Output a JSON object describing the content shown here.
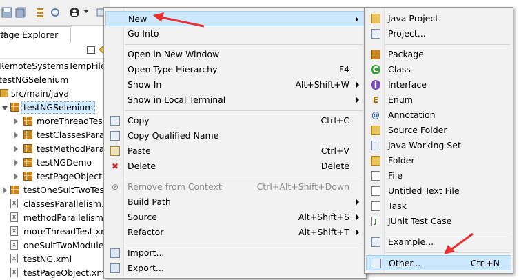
{
  "view": {
    "tab_label": "tage Explorer",
    "close_glyph": "✕"
  },
  "tree": [
    {
      "label": "RemoteSystemsTempFiles",
      "icon": "folder-icon"
    },
    {
      "label": "testNGSelenium",
      "icon": "project-icon"
    },
    {
      "label": "src/main/java",
      "icon": "source-folder-icon"
    },
    {
      "label": "testNGSelenium",
      "icon": "package-icon",
      "selected": true
    },
    {
      "label": "moreThreadTest",
      "icon": "package-icon"
    },
    {
      "label": "testClassesParalle",
      "icon": "package-icon"
    },
    {
      "label": "testMethodParall",
      "icon": "package-icon"
    },
    {
      "label": "testNGDemo",
      "icon": "package-icon"
    },
    {
      "label": "testPageObject",
      "icon": "package-icon"
    },
    {
      "label": "testOneSuitTwoTest",
      "icon": "package-icon"
    },
    {
      "label": "classesParallelism.xm",
      "icon": "xml-file-icon"
    },
    {
      "label": "methodParallelism.x",
      "icon": "xml-file-icon"
    },
    {
      "label": "moreThreadTest.xm",
      "icon": "xml-file-icon"
    },
    {
      "label": "oneSuitTwoModuleT",
      "icon": "xml-file-icon"
    },
    {
      "label": "testNG.xml",
      "icon": "xml-file-icon"
    },
    {
      "label": "testPageObject.xml",
      "icon": "xml-file-icon"
    }
  ],
  "context_menu": {
    "items": [
      {
        "label": "New",
        "shortcut": "",
        "submenu": true,
        "highlighted": true
      },
      {
        "label": "Go Into",
        "shortcut": ""
      },
      {
        "label": "Open in New Window",
        "shortcut": ""
      },
      {
        "label": "Open Type Hierarchy",
        "shortcut": "F4"
      },
      {
        "label": "Show In",
        "shortcut": "Alt+Shift+W",
        "submenu": true
      },
      {
        "label": "Show in Local Terminal",
        "shortcut": "",
        "submenu": true
      },
      {
        "label": "Copy",
        "shortcut": "Ctrl+C"
      },
      {
        "label": "Copy Qualified Name",
        "shortcut": ""
      },
      {
        "label": "Paste",
        "shortcut": "Ctrl+V"
      },
      {
        "label": "Delete",
        "shortcut": "Delete"
      },
      {
        "label": "Remove from Context",
        "shortcut": "Ctrl+Alt+Shift+Down",
        "disabled": true
      },
      {
        "label": "Build Path",
        "shortcut": "",
        "submenu": true
      },
      {
        "label": "Source",
        "shortcut": "Alt+Shift+S",
        "submenu": true
      },
      {
        "label": "Refactor",
        "shortcut": "Alt+Shift+T",
        "submenu": true
      },
      {
        "label": "Import...",
        "shortcut": ""
      },
      {
        "label": "Export...",
        "shortcut": ""
      }
    ]
  },
  "new_submenu": {
    "items": [
      {
        "label": "Java Project",
        "shortcut": ""
      },
      {
        "label": "Project...",
        "shortcut": ""
      },
      {
        "label": "Package",
        "shortcut": ""
      },
      {
        "label": "Class",
        "shortcut": ""
      },
      {
        "label": "Interface",
        "shortcut": ""
      },
      {
        "label": "Enum",
        "shortcut": ""
      },
      {
        "label": "Annotation",
        "shortcut": ""
      },
      {
        "label": "Source Folder",
        "shortcut": ""
      },
      {
        "label": "Java Working Set",
        "shortcut": ""
      },
      {
        "label": "Folder",
        "shortcut": ""
      },
      {
        "label": "File",
        "shortcut": ""
      },
      {
        "label": "Untitled Text File",
        "shortcut": ""
      },
      {
        "label": "Task",
        "shortcut": ""
      },
      {
        "label": "JUnit Test Case",
        "shortcut": ""
      },
      {
        "label": "Example...",
        "shortcut": ""
      },
      {
        "label": "Other...",
        "shortcut": "Ctrl+N",
        "highlighted": true
      }
    ]
  },
  "colors": {
    "highlight_bg": "#cce8ff",
    "menu_bg": "#f2f2f2",
    "annotation_arrow": "#e8312f"
  }
}
